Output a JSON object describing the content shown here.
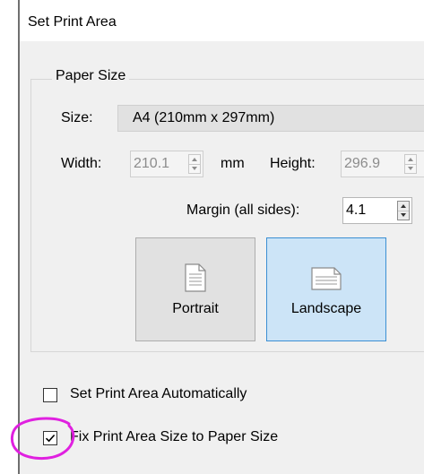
{
  "dialog": {
    "title": "Set Print Area"
  },
  "paper_size": {
    "group_label": "Paper Size",
    "size_label": "Size:",
    "size_value": "A4 (210mm x 297mm)",
    "width_label": "Width:",
    "width_value": "210.1",
    "unit_label": "mm",
    "height_label": "Height:",
    "height_value": "296.9",
    "margin_label": "Margin (all sides):",
    "margin_value": "4.1"
  },
  "orientation": {
    "portrait_label": "Portrait",
    "landscape_label": "Landscape",
    "selected": "landscape"
  },
  "options": {
    "auto_label": "Set Print Area Automatically",
    "auto_checked": false,
    "fix_label": "Fix Print Area Size to Paper Size",
    "fix_checked": true
  },
  "colors": {
    "panel_bg": "#f0f0f0",
    "selected_bg": "#cce4f7",
    "selected_border": "#3c8fd3",
    "highlight": "#e020e0"
  },
  "icons": {
    "portrait": "document-portrait-icon",
    "landscape": "document-landscape-icon",
    "check": "checkmark-icon"
  }
}
